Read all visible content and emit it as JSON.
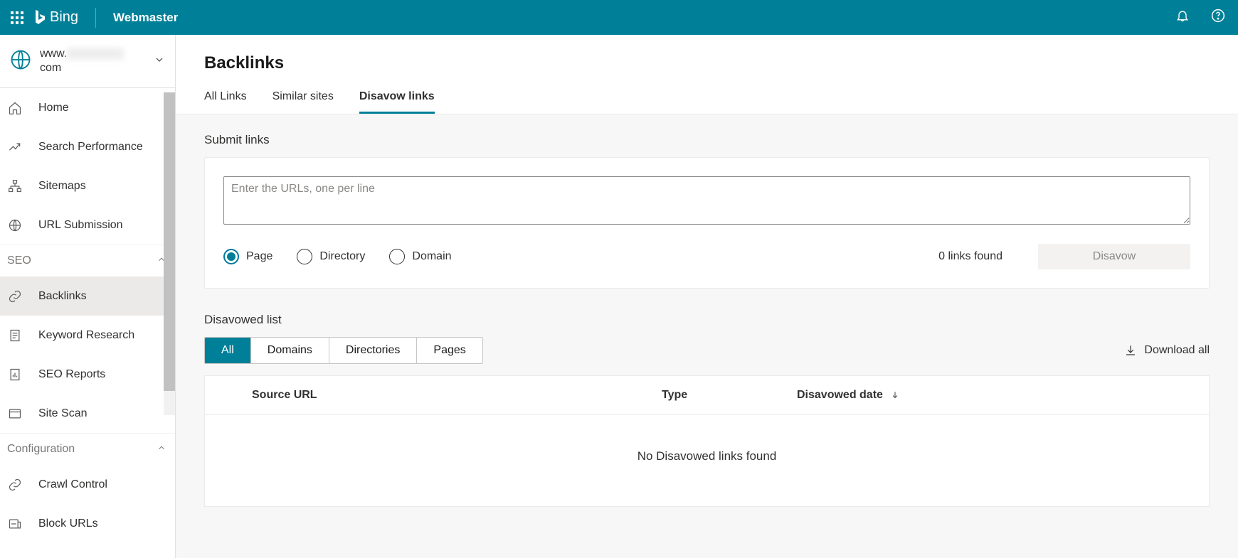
{
  "header": {
    "brand_bing": "Bing",
    "brand_app": "Webmaster"
  },
  "site_picker": {
    "line1_prefix": "www.",
    "line1_blur": "xxxxxxxxxx",
    "line2": "com"
  },
  "nav": {
    "home": "Home",
    "search_performance": "Search Performance",
    "sitemaps": "Sitemaps",
    "url_submission": "URL Submission",
    "section_seo": "SEO",
    "backlinks": "Backlinks",
    "keyword_research": "Keyword Research",
    "seo_reports": "SEO Reports",
    "site_scan": "Site Scan",
    "section_configuration": "Configuration",
    "crawl_control": "Crawl Control",
    "block_urls": "Block URLs"
  },
  "page": {
    "title": "Backlinks",
    "tabs": {
      "all_links": "All Links",
      "similar_sites": "Similar sites",
      "disavow_links": "Disavow links"
    }
  },
  "submit": {
    "label": "Submit links",
    "placeholder": "Enter the URLs, one per line",
    "radio_page": "Page",
    "radio_directory": "Directory",
    "radio_domain": "Domain",
    "links_found": "0 links found",
    "disavow_btn": "Disavow"
  },
  "list": {
    "label": "Disavowed list",
    "pill_all": "All",
    "pill_domains": "Domains",
    "pill_directories": "Directories",
    "pill_pages": "Pages",
    "download_all": "Download all",
    "col_source": "Source URL",
    "col_type": "Type",
    "col_date": "Disavowed date",
    "empty": "No Disavowed links found"
  }
}
